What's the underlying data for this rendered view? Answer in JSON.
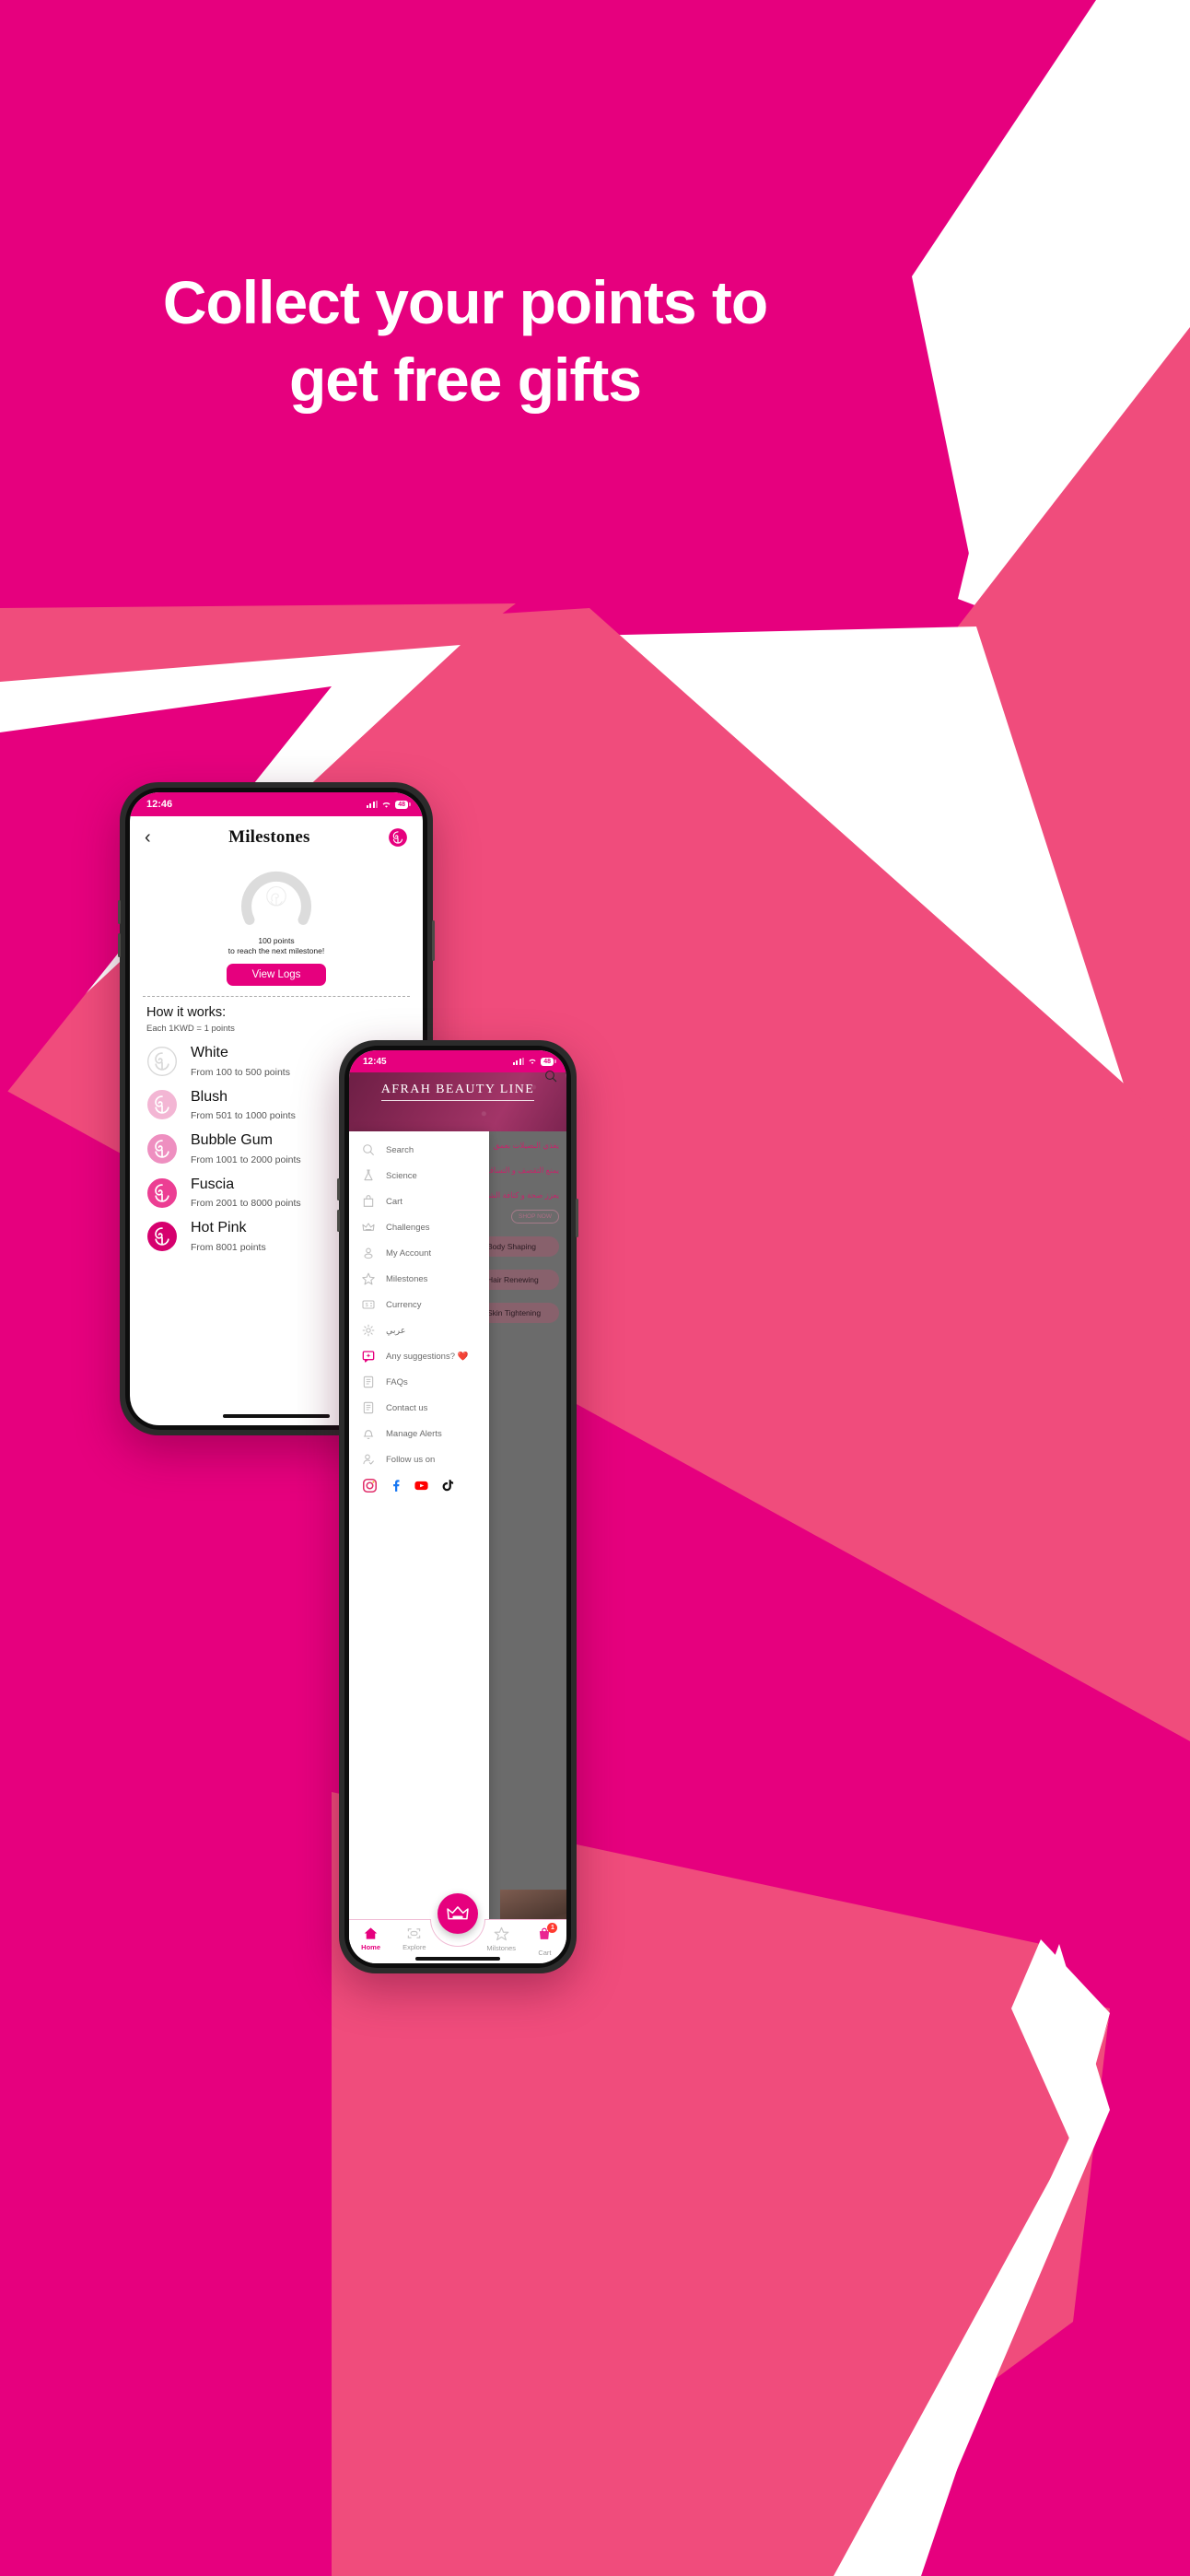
{
  "promo": {
    "headline_line1": "Collect your points to",
    "headline_line2": "get free gifts",
    "colors": {
      "brand_magenta": "#E6007E",
      "light_pink": "#F04C7C",
      "white": "#FFFFFF"
    }
  },
  "phone1": {
    "status_bar": {
      "time": "12:46",
      "battery": "48",
      "wifi_icon": "wifi-icon",
      "signal_icon": "cellular-signal-icon"
    },
    "header": {
      "back_icon": "chevron-left-icon",
      "title": "Milestones",
      "logo_icon": "rose-logo-icon"
    },
    "gauge": {
      "center_icon": "rose-outline-icon",
      "progress_percent": 0
    },
    "progress": {
      "points": "100 points",
      "caption": "to reach the next milestone!"
    },
    "view_logs_button": "View Logs",
    "how_it_works": {
      "title": "How it works:",
      "rule": "Each 1KWD = 1  points"
    },
    "tiers": [
      {
        "name": "White",
        "range": "From 100 to 500 points",
        "color": "#FFFFFF",
        "stroke": "#d8d8d8",
        "icon": "rose-logo-icon"
      },
      {
        "name": "Blush",
        "range": "From 501 to 1000 points",
        "color": "#F3B6D4",
        "stroke": "#F3B6D4",
        "icon": "rose-logo-icon"
      },
      {
        "name": "Bubble Gum",
        "range": "From 1001 to 2000 points",
        "color": "#EE8FC0",
        "stroke": "#EE8FC0",
        "icon": "rose-logo-icon"
      },
      {
        "name": "Fuscia",
        "range": "From 2001 to 8000 points",
        "color": "#EC3E93",
        "stroke": "#EC3E93",
        "icon": "rose-logo-icon"
      },
      {
        "name": "Hot Pink",
        "range": "From 8001 points",
        "color": "#D6006E",
        "stroke": "#D6006E",
        "icon": "rose-logo-icon"
      }
    ]
  },
  "phone2": {
    "status_bar": {
      "time": "12:45",
      "battery": "48",
      "wifi_icon": "wifi-icon",
      "signal_icon": "cellular-signal-icon"
    },
    "banner": {
      "brand": "AFRAH BEAUTY LINE",
      "search_icon": "search-icon"
    },
    "drawer_items": [
      {
        "label": "Search",
        "icon": "search-icon"
      },
      {
        "label": "Science",
        "icon": "flask-icon"
      },
      {
        "label": "Cart",
        "icon": "shopping-bag-icon"
      },
      {
        "label": "Challenges",
        "icon": "crown-icon"
      },
      {
        "label": "My Account",
        "icon": "person-icon"
      },
      {
        "label": "Milestones",
        "icon": "star-icon"
      },
      {
        "label": "Currency",
        "icon": "currency-card-icon"
      },
      {
        "label": "عربي",
        "icon": "gear-icon"
      },
      {
        "label": "Any suggestions? ❤️",
        "icon": "suggestion-bubble-icon"
      },
      {
        "label": "FAQs",
        "icon": "document-icon"
      },
      {
        "label": "Contact us",
        "icon": "document-icon"
      },
      {
        "label": "Manage Alerts",
        "icon": "bell-icon"
      },
      {
        "label": "Follow us on",
        "icon": "person-check-icon"
      }
    ],
    "socials": [
      {
        "name": "instagram-icon"
      },
      {
        "name": "facebook-icon"
      },
      {
        "name": "youtube-icon"
      },
      {
        "name": "tiktok-icon"
      }
    ],
    "background_content": {
      "arabic_lines": [
        "يغذي البصيلات بعمق",
        "يمنع التقصف و التساقط",
        "يعزز صحة و كثافة الشعر"
      ],
      "shop_now": "SHOP NOW",
      "category_pills": [
        "Body Shaping",
        "Hair Renewing",
        "Skin Tightening"
      ]
    },
    "fab": {
      "icon": "crown-icon"
    },
    "tabbar": [
      {
        "label": "Home",
        "icon": "home-icon",
        "active": true,
        "badge": ""
      },
      {
        "label": "Explore",
        "icon": "scan-icon",
        "active": false,
        "badge": ""
      },
      {
        "label": "Milstones",
        "icon": "star-icon",
        "active": false,
        "badge": ""
      },
      {
        "label": "Cart",
        "icon": "cart-icon",
        "active": false,
        "badge": "1"
      }
    ]
  }
}
